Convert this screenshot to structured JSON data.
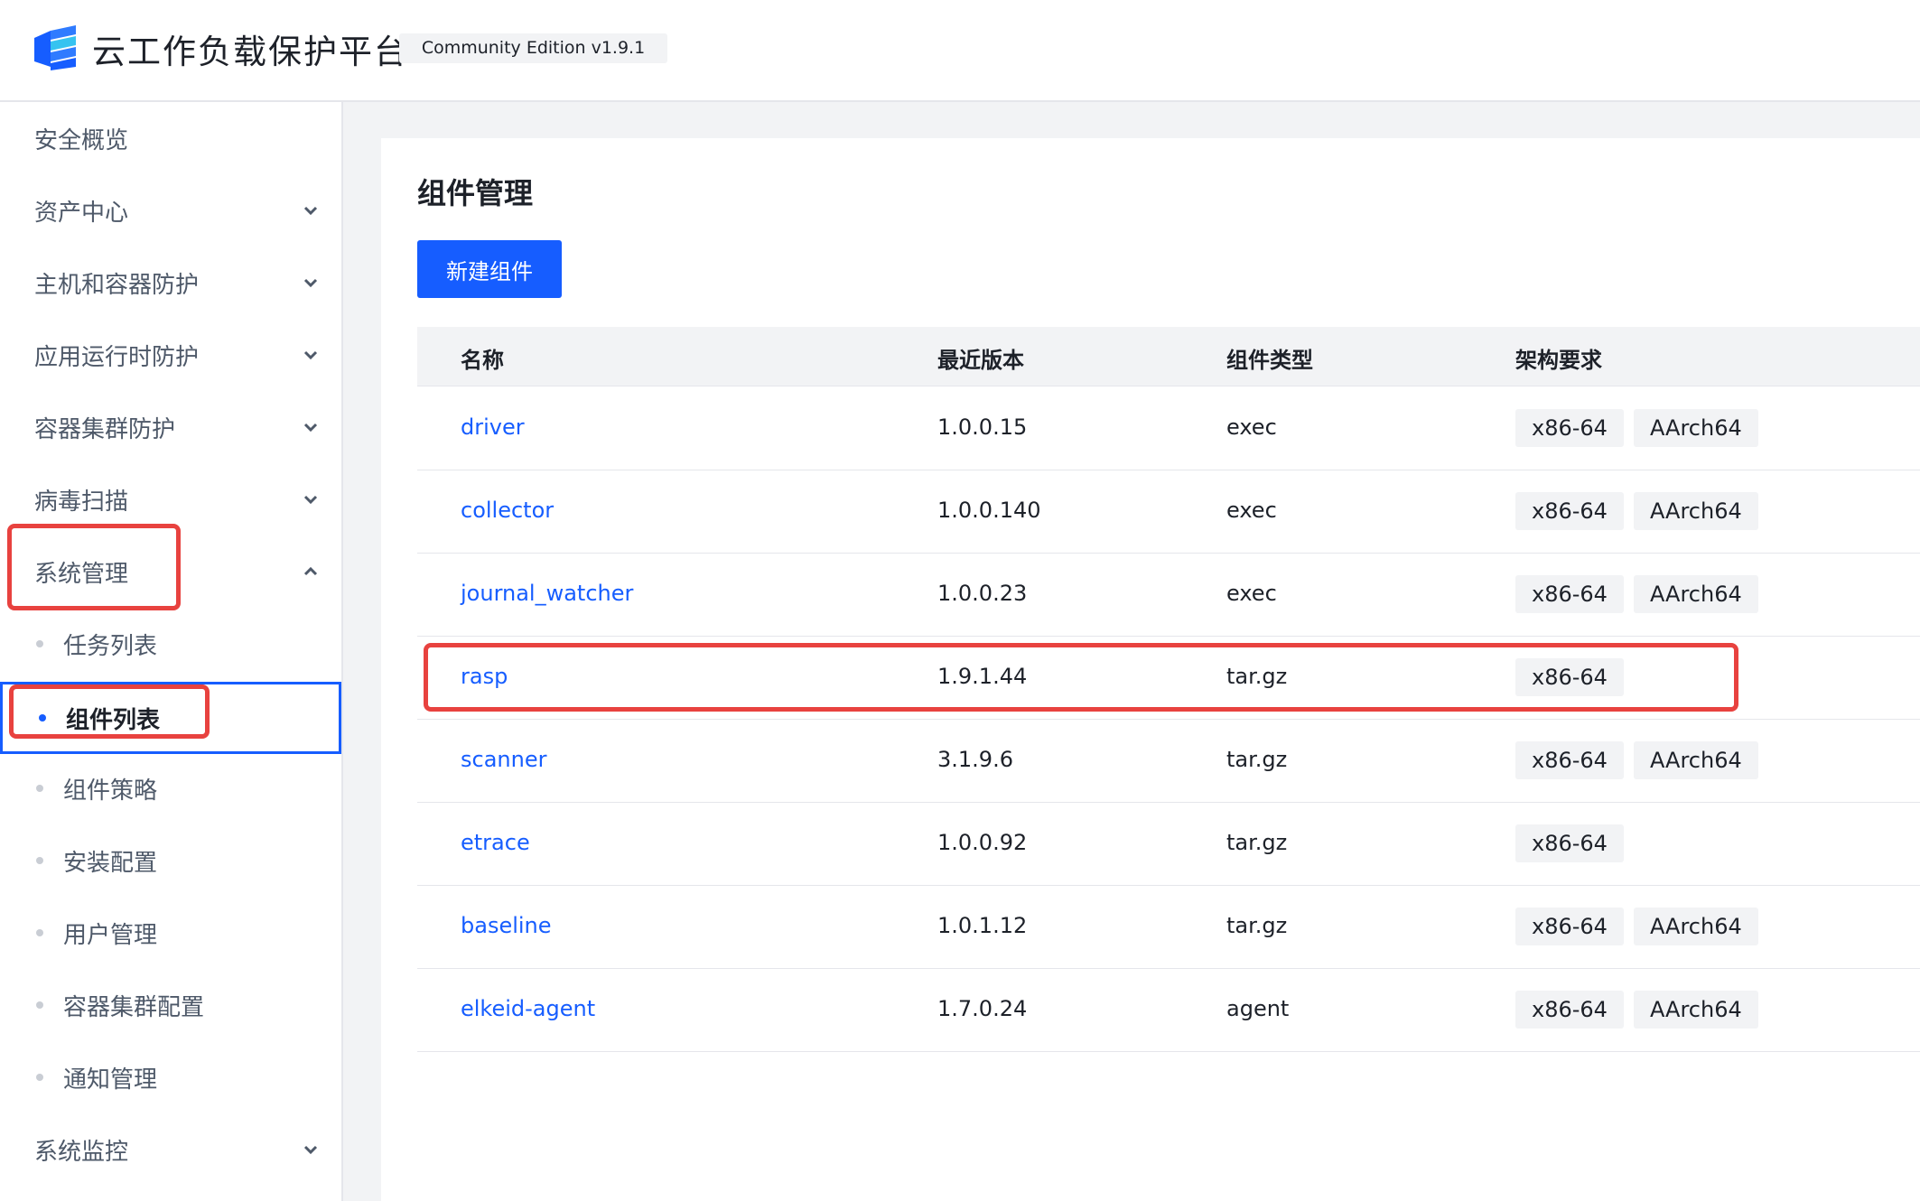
{
  "header": {
    "title": "云工作负载保护平台",
    "edition": "Community Edition v1.9.1",
    "logo_icon": "stacked-layers-logo",
    "accent_color": "#165dff"
  },
  "sidebar": {
    "items": [
      {
        "label": "安全概览",
        "has_chevron": false
      },
      {
        "label": "资产中心",
        "has_chevron": true,
        "expanded": false
      },
      {
        "label": "主机和容器防护",
        "has_chevron": true,
        "expanded": false
      },
      {
        "label": "应用运行时防护",
        "has_chevron": true,
        "expanded": false
      },
      {
        "label": "容器集群防护",
        "has_chevron": true,
        "expanded": false
      },
      {
        "label": "病毒扫描",
        "has_chevron": true,
        "expanded": false
      },
      {
        "label": "系统管理",
        "has_chevron": true,
        "expanded": true
      },
      {
        "label": "系统监控",
        "has_chevron": true,
        "expanded": false
      }
    ],
    "sub_items": [
      {
        "label": "任务列表",
        "active": false
      },
      {
        "label": "组件列表",
        "active": true
      },
      {
        "label": "组件策略",
        "active": false
      },
      {
        "label": "安装配置",
        "active": false
      },
      {
        "label": "用户管理",
        "active": false
      },
      {
        "label": "容器集群配置",
        "active": false
      },
      {
        "label": "通知管理",
        "active": false
      }
    ]
  },
  "main": {
    "title": "组件管理",
    "new_button": "新建组件",
    "columns": [
      "名称",
      "最近版本",
      "组件类型",
      "架构要求"
    ],
    "rows": [
      {
        "name": "driver",
        "version": "1.0.0.15",
        "type": "exec",
        "arch": [
          "x86-64",
          "AArch64"
        ]
      },
      {
        "name": "collector",
        "version": "1.0.0.140",
        "type": "exec",
        "arch": [
          "x86-64",
          "AArch64"
        ]
      },
      {
        "name": "journal_watcher",
        "version": "1.0.0.23",
        "type": "exec",
        "arch": [
          "x86-64",
          "AArch64"
        ]
      },
      {
        "name": "rasp",
        "version": "1.9.1.44",
        "type": "tar.gz",
        "arch": [
          "x86-64"
        ]
      },
      {
        "name": "scanner",
        "version": "3.1.9.6",
        "type": "tar.gz",
        "arch": [
          "x86-64",
          "AArch64"
        ]
      },
      {
        "name": "etrace",
        "version": "1.0.0.92",
        "type": "tar.gz",
        "arch": [
          "x86-64"
        ]
      },
      {
        "name": "baseline",
        "version": "1.0.1.12",
        "type": "tar.gz",
        "arch": [
          "x86-64",
          "AArch64"
        ]
      },
      {
        "name": "elkeid-agent",
        "version": "1.7.0.24",
        "type": "agent",
        "arch": [
          "x86-64",
          "AArch64"
        ]
      }
    ]
  },
  "annotation_color": "#e8423f"
}
